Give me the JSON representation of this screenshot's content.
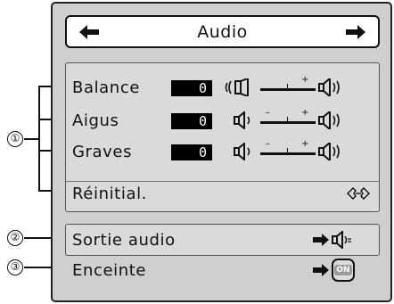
{
  "header": {
    "title": "Audio"
  },
  "callouts": [
    "①",
    "②",
    "③"
  ],
  "adjustments": [
    {
      "label": "Balance",
      "value": "0"
    },
    {
      "label": "Aigus",
      "value": "0"
    },
    {
      "label": "Graves",
      "value": "0"
    }
  ],
  "reset": {
    "label": "Réinitial."
  },
  "audio_out": {
    "label": "Sortie audio"
  },
  "speaker": {
    "label": "Enceinte",
    "toggle": "ON"
  },
  "slider_marks": {
    "minus": "–",
    "plus": "+"
  }
}
